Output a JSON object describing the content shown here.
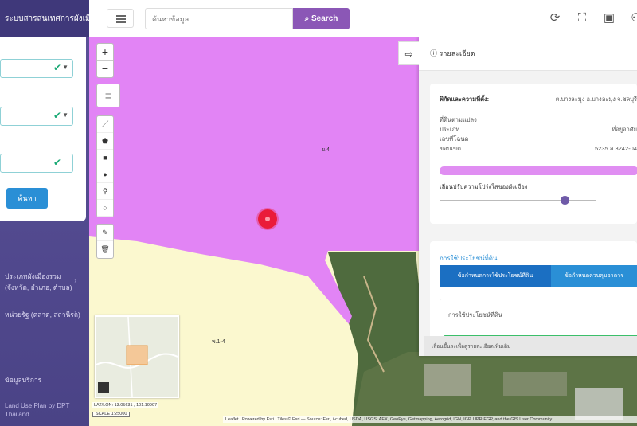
{
  "sidebar": {
    "title": "ระบบสารสนเทศการผังเมือง",
    "submit_label": "ค้นหา",
    "items": [
      {
        "label": "ประเภทผังเมืองรวม"
      },
      {
        "label": "(จังหวัด, อำเภอ, ตำบล)"
      },
      {
        "label": "หน่วยรัฐ (ตลาด, สถานีรถ)"
      },
      {
        "label": "ข้อมูลบริการ"
      }
    ],
    "footer": "Land Use Plan by DPT Thailand"
  },
  "topbar": {
    "search_placeholder": "ค้นหาข้อมูล...",
    "search_label": "Search"
  },
  "map": {
    "zone_label_main": "ย.4",
    "zone_label_yellow": "พ.1-4",
    "coords": "LAT/LON: 13.05631 , 101.19997",
    "scale": "SCALE 1:25000",
    "attribution": "Leaflet | Powered by Esri | Tiles © Esri — Source: Esri, i-cubed, USDA, USGS, AEX, GeoEye, Getmapping, Aerogrid, IGN, IGP, UPR-EGP, and the GIS User Community",
    "colors": {
      "zone_purple": "#e284f5",
      "zone_yellow": "#fbf8cf",
      "marker": "#ea1b3a"
    }
  },
  "detail": {
    "title": "รายละเอียด",
    "section1": {
      "heading": "พิกัดและความที่ตั้ง:",
      "heading_value": "ต.บางละมุง อ.บางละมุง จ.ชลบุรี",
      "rows": [
        {
          "label": "ที่ดินตามแปลง",
          "value": ""
        },
        {
          "label": "ประเภท",
          "value": "ที่อยู่อาศัย"
        },
        {
          "label": "เลขที่โฉนด",
          "value": ""
        },
        {
          "label": "ขอบเขต",
          "value": "5235 ล 3242-04"
        }
      ],
      "slider_label": "เลื่อนปรับความโปร่งใสของผังเมือง",
      "progress": 1.0,
      "opacity": 0.8
    },
    "section2": {
      "title": "การใช้ประโยชน์ที่ดิน",
      "tab_active": "ข้อกำหนดการใช้ประโยชน์ที่ดิน",
      "tab_inactive": "ข้อกำหนดควบคุมอาคาร",
      "body_label": "การใช้ประโยชน์ที่ดิน"
    },
    "footer_text": "เลื่อนขึ้นลงเพื่อดูรายละเอียดเพิ่มเติม"
  }
}
